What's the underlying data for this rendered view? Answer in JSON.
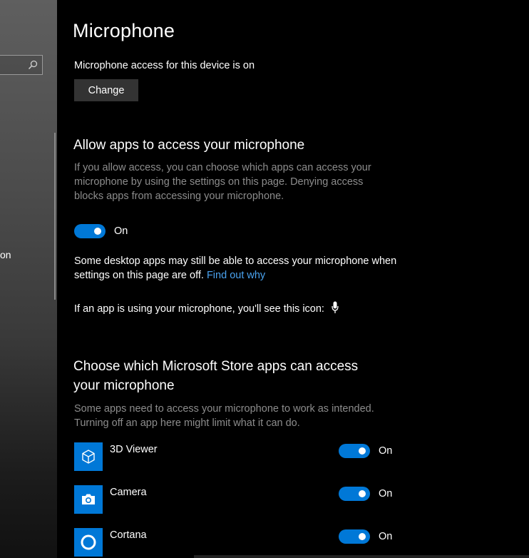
{
  "nav": {
    "partial_item_label": "on"
  },
  "page": {
    "title": "Microphone",
    "device_access_status": "Microphone access for this device is on",
    "change_button_label": "Change"
  },
  "allow_apps": {
    "heading": "Allow apps to access your microphone",
    "description": "If you allow access, you can choose which apps can access your microphone by using the settings on this page. Denying access blocks apps from accessing your microphone.",
    "toggle_state": "On",
    "desktop_note": "Some desktop apps may still be able to access your microphone when settings on this page are off.",
    "find_out_link": "Find out why",
    "icon_note": "If an app is using your microphone, you'll see this icon:"
  },
  "store_apps": {
    "heading": "Choose which Microsoft Store apps can access your microphone",
    "description": "Some apps need to access your microphone to work as intended. Turning off an app here might limit what it can do.",
    "apps": [
      {
        "name": "3D Viewer",
        "state": "On",
        "icon": "cube-icon"
      },
      {
        "name": "Camera",
        "state": "On",
        "icon": "camera-icon"
      },
      {
        "name": "Cortana",
        "state": "On",
        "icon": "cortana-ring-icon"
      }
    ]
  },
  "colors": {
    "accent": "#0078d7",
    "link": "#4aa3f0",
    "muted_text": "#8c8c8c",
    "button_bg": "#333333"
  }
}
